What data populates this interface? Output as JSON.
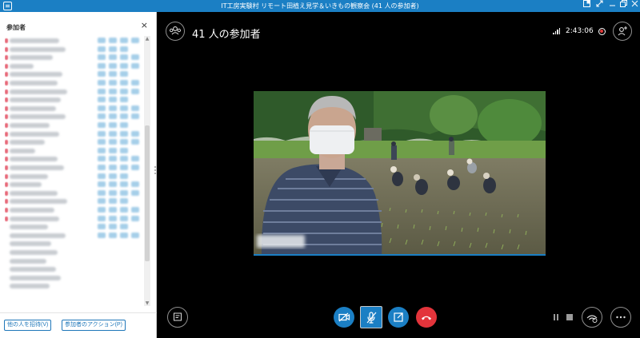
{
  "window": {
    "title": "IT工房実験村 リモート田植え見学＆いきもの観察会 (41 人の参加者)",
    "app_icon": "skype-chat-icon",
    "controls": [
      "pin-icon",
      "expand-icon",
      "minimize-icon",
      "restore-icon",
      "close-icon"
    ]
  },
  "sidebar": {
    "header": "参加者",
    "close_label": "×",
    "invite_button": "他の人を招待(V)",
    "actions_button": "参加者のアクション(P)"
  },
  "call": {
    "participant_count_title": "41 人の参加者",
    "elapsed_time": "2:43:06",
    "recording_color": "#e23b3b",
    "accent_color": "#1b7fc4",
    "hangup_color": "#e3343b"
  },
  "controls": {
    "left": "chat-icon",
    "center": [
      "camera-off-icon",
      "mic-muted-icon",
      "share-screen-icon",
      "hang-up-icon"
    ],
    "right": [
      "pause-icon",
      "stop-icon",
      "device-settings-icon",
      "more-options-icon"
    ]
  }
}
